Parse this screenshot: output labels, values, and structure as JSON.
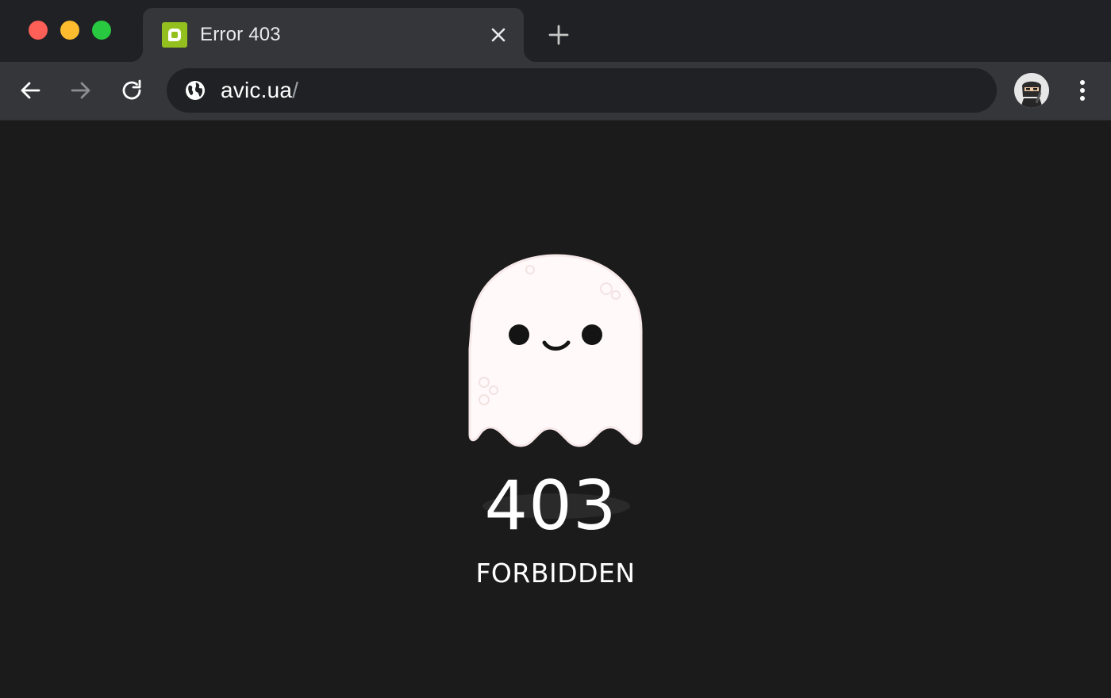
{
  "window": {
    "controls": [
      "close",
      "minimize",
      "maximize"
    ],
    "colors": {
      "close": "#fe5f57",
      "minimize": "#febc2e",
      "maximize": "#28c840"
    }
  },
  "tab": {
    "title": "Error 403",
    "favicon": "avic-logo-icon",
    "favicon_color": "#93c01f",
    "close_icon": "close-icon"
  },
  "new_tab_icon": "plus-icon",
  "toolbar": {
    "back_icon": "arrow-left-icon",
    "forward_icon": "arrow-right-icon",
    "reload_icon": "reload-icon",
    "site_info_icon": "globe-icon",
    "url_host": "avic.ua",
    "url_path": "/",
    "profile_icon": "avatar",
    "menu_icon": "kebab-menu-icon"
  },
  "page": {
    "illustration": "ghost-icon",
    "error_code": "403",
    "error_label": "FORBIDDEN",
    "background": "#1b1b1c"
  }
}
